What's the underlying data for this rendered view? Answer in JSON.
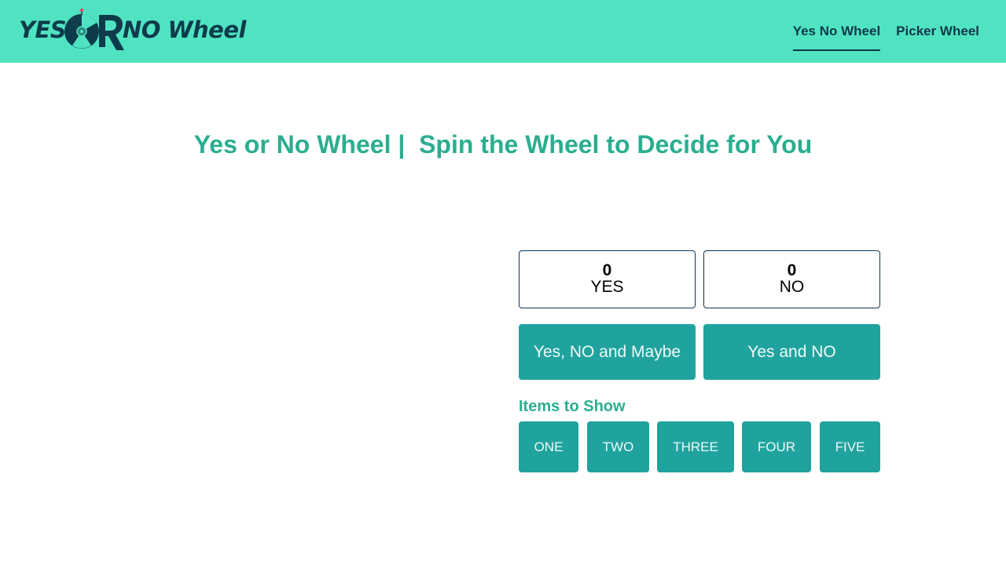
{
  "header": {
    "logo": {
      "text_left": "YES",
      "text_right": "NO Wheel",
      "icon": "wheel-icon"
    },
    "nav": [
      {
        "label": "Yes No Wheel",
        "active": true
      },
      {
        "label": "Picker Wheel",
        "active": false
      }
    ],
    "colors": {
      "bar": "#50e3c2",
      "nav_text": "#103848"
    }
  },
  "main": {
    "title": "Yes or No Wheel |  Spin the Wheel to Decide for You"
  },
  "scores": [
    {
      "count": "0",
      "label": "YES"
    },
    {
      "count": "0",
      "label": "NO"
    }
  ],
  "modes": [
    {
      "label": "Yes, NO and Maybe"
    },
    {
      "label": "Yes and NO"
    }
  ],
  "items": {
    "heading": "Items to Show",
    "options": [
      "ONE",
      "TWO",
      "THREE",
      "FOUR",
      "FIVE"
    ]
  },
  "colors": {
    "accent_text": "#2bae8f",
    "button_bg": "#20a39e",
    "score_border": "#0d3553"
  }
}
